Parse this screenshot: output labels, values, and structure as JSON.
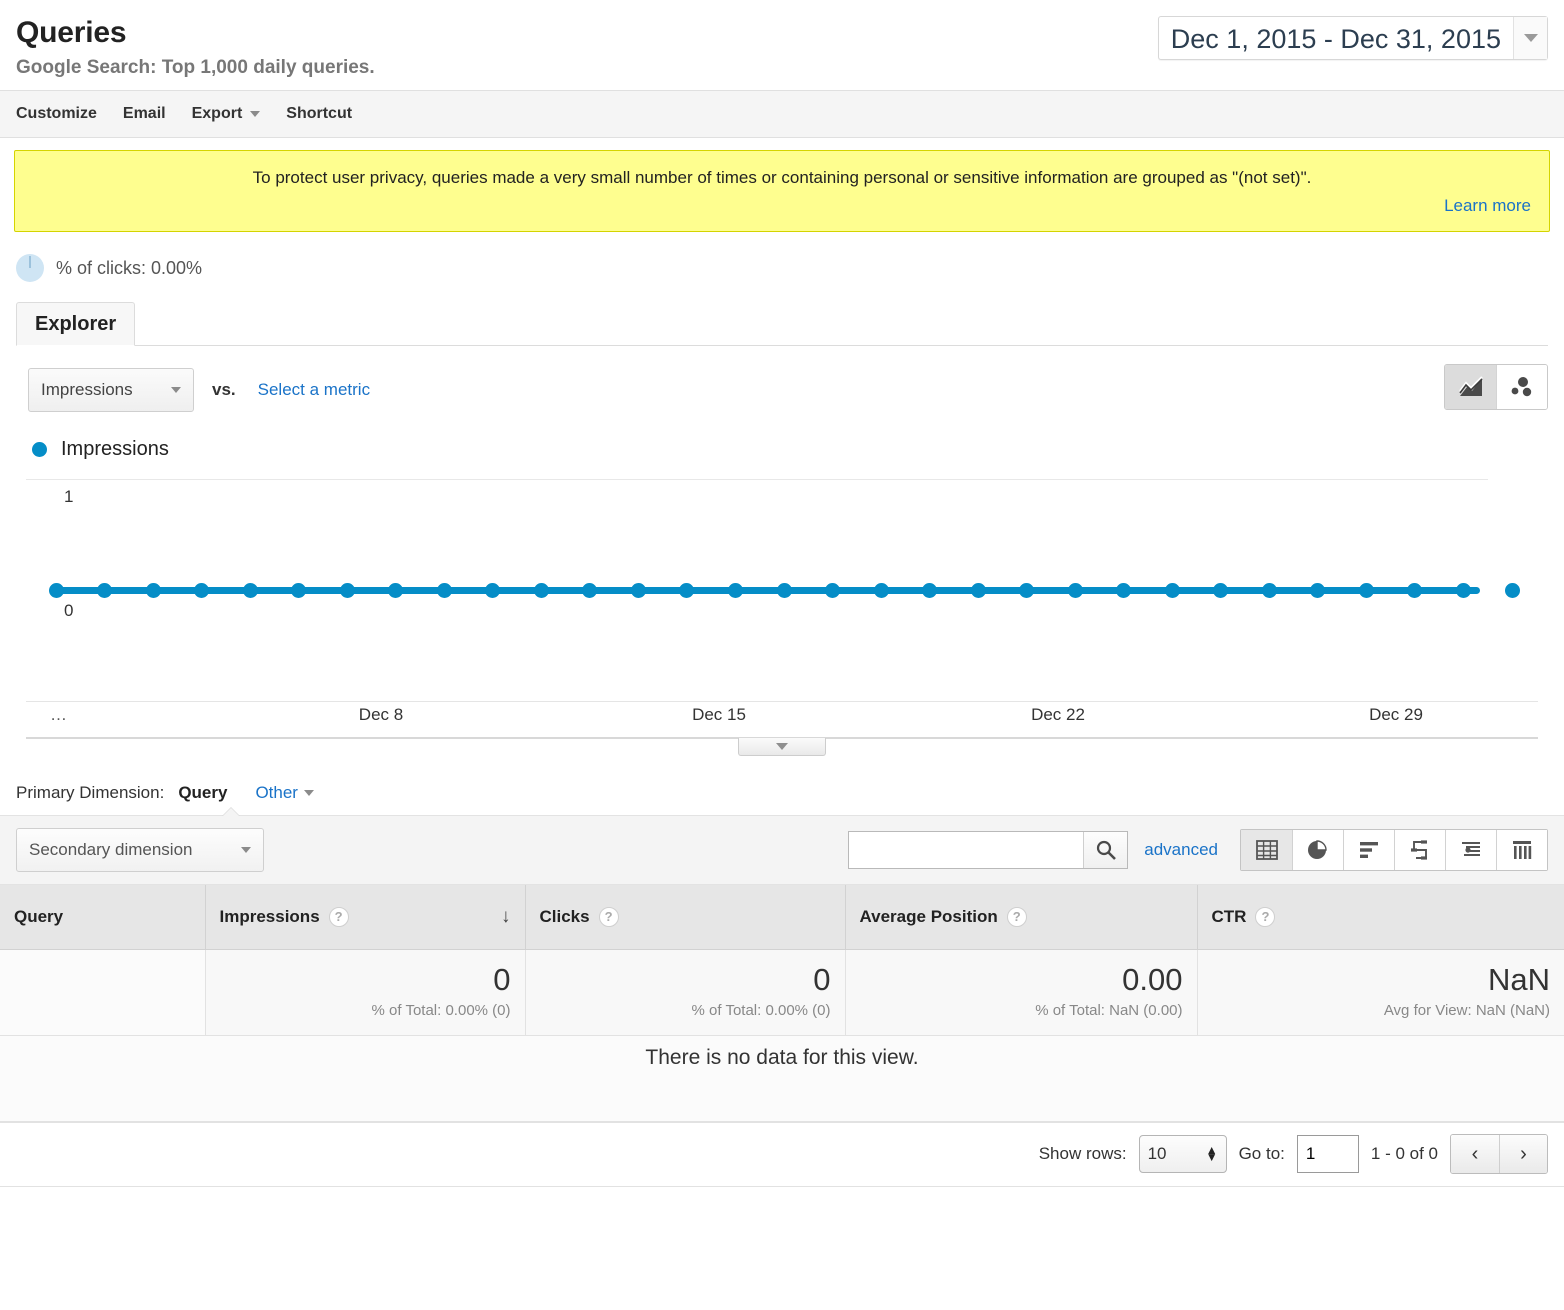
{
  "header": {
    "title": "Queries",
    "subtitle": "Google Search: Top 1,000 daily queries.",
    "date_range": "Dec 1, 2015 - Dec 31, 2015"
  },
  "toolbar": {
    "customize": "Customize",
    "email": "Email",
    "export": "Export",
    "shortcut": "Shortcut"
  },
  "notice": {
    "text": "To protect user privacy, queries made a very small number of times or containing personal or sensitive information are grouped as \"(not set)\".",
    "link": "Learn more"
  },
  "clicks_summary": {
    "label": "% of clicks: 0.00%",
    "icon": "pie-zero-icon"
  },
  "tabs": [
    {
      "label": "Explorer",
      "active": true
    }
  ],
  "metric_controls": {
    "selected_metric": "Impressions",
    "vs_label": "vs.",
    "select_metric_link": "Select a metric",
    "chart_types": [
      {
        "name": "line-chart-icon",
        "active": true
      },
      {
        "name": "motion-chart-icon",
        "active": false
      }
    ]
  },
  "legend": {
    "series_name": "Impressions",
    "color": "#058dc7"
  },
  "chart_data": {
    "type": "line",
    "title": "Impressions",
    "xlabel": "",
    "ylabel": "",
    "ylim": [
      0,
      1
    ],
    "ytick_labels": [
      "1",
      "0"
    ],
    "grid": true,
    "legend_position": "top-left",
    "x_tick_labels": [
      "…",
      "Dec 8",
      "Dec 15",
      "Dec 22",
      "Dec 29"
    ],
    "x": [
      "Dec 1",
      "Dec 2",
      "Dec 3",
      "Dec 4",
      "Dec 5",
      "Dec 6",
      "Dec 7",
      "Dec 8",
      "Dec 9",
      "Dec 10",
      "Dec 11",
      "Dec 12",
      "Dec 13",
      "Dec 14",
      "Dec 15",
      "Dec 16",
      "Dec 17",
      "Dec 18",
      "Dec 19",
      "Dec 20",
      "Dec 21",
      "Dec 22",
      "Dec 23",
      "Dec 24",
      "Dec 25",
      "Dec 26",
      "Dec 27",
      "Dec 28",
      "Dec 29",
      "Dec 30",
      "Dec 31"
    ],
    "series": [
      {
        "name": "Impressions",
        "color": "#058dc7",
        "values": [
          0,
          0,
          0,
          0,
          0,
          0,
          0,
          0,
          0,
          0,
          0,
          0,
          0,
          0,
          0,
          0,
          0,
          0,
          0,
          0,
          0,
          0,
          0,
          0,
          0,
          0,
          0,
          0,
          0,
          0,
          0
        ]
      }
    ]
  },
  "primary_dimension": {
    "label": "Primary Dimension:",
    "active": "Query",
    "other": "Other"
  },
  "table_controls": {
    "secondary_dimension": "Secondary dimension",
    "search_placeholder": "",
    "search_value": "",
    "advanced_link": "advanced",
    "view_icons": [
      {
        "name": "table-view-icon",
        "active": true
      },
      {
        "name": "pie-view-icon",
        "active": false
      },
      {
        "name": "bar-view-icon",
        "active": false
      },
      {
        "name": "performance-view-icon",
        "active": false
      },
      {
        "name": "comparison-view-icon",
        "active": false
      },
      {
        "name": "pivot-view-icon",
        "active": false
      }
    ]
  },
  "table": {
    "columns": [
      {
        "label": "Query",
        "has_help": false,
        "sorted": false
      },
      {
        "label": "Impressions",
        "has_help": true,
        "sorted": true,
        "sort_arrow": "↓"
      },
      {
        "label": "Clicks",
        "has_help": true,
        "sorted": false
      },
      {
        "label": "Average Position",
        "has_help": true,
        "sorted": false
      },
      {
        "label": "CTR",
        "has_help": true,
        "sorted": false
      }
    ],
    "summary_row": {
      "query": "",
      "impressions": {
        "value": "0",
        "sub": "% of Total: 0.00% (0)"
      },
      "clicks": {
        "value": "0",
        "sub": "% of Total: 0.00% (0)"
      },
      "average_position": {
        "value": "0.00",
        "sub": "% of Total: NaN (0.00)"
      },
      "ctr": {
        "value": "NaN",
        "sub": "Avg for View: NaN (NaN)"
      }
    },
    "no_data_message": "There is no data for this view."
  },
  "footer": {
    "show_rows_label": "Show rows:",
    "show_rows_value": "10",
    "goto_label": "Go to:",
    "goto_value": "1",
    "range_text": "1 - 0 of 0",
    "prev": "‹",
    "next": "›"
  }
}
